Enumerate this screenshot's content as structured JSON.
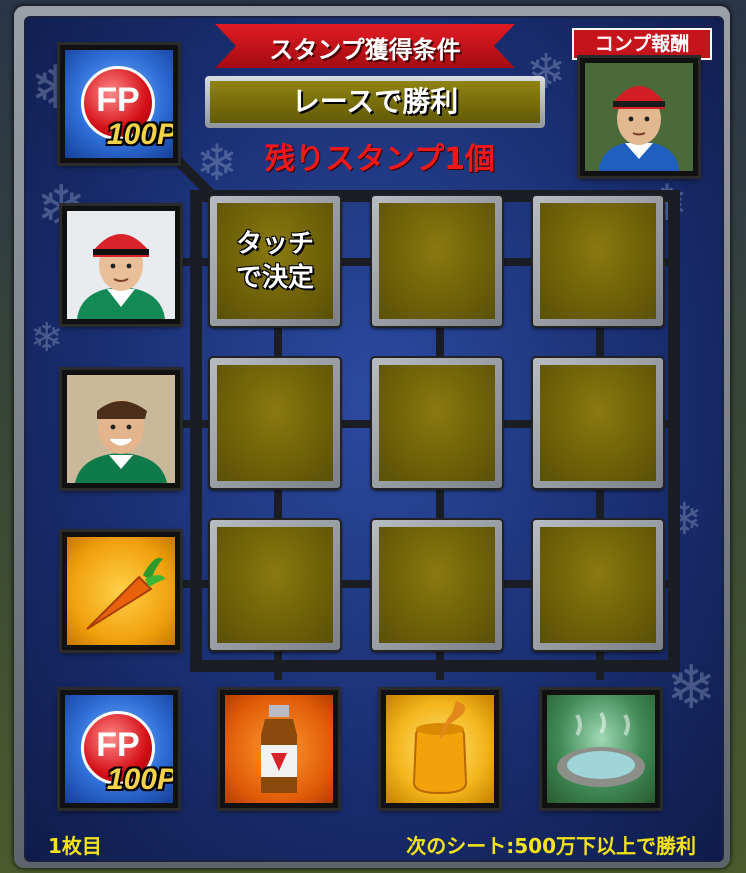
{
  "header": {
    "ribbon_title": "スタンプ獲得条件",
    "condition": "レースで勝利",
    "remaining": "残りスタンプ1個",
    "comp_reward_label": "コンプ報酬"
  },
  "grid": {
    "cells": [
      "タッチ\nで決定",
      "",
      "",
      "",
      "",
      "",
      "",
      "",
      ""
    ]
  },
  "rewards": {
    "corner_top_left": {
      "type": "fp",
      "coin": "FP",
      "points": "100P"
    },
    "corner_bottom_left": {
      "type": "fp",
      "coin": "FP",
      "points": "100P"
    },
    "row_rewards": [
      "jockey-portrait",
      "jockey-portrait",
      "carrot"
    ],
    "col_rewards": [
      "energy-drink",
      "honey",
      "hot-spring"
    ],
    "complete": "jockey-portrait"
  },
  "footer": {
    "sheet_number": "1枚目",
    "next_sheet": "次のシート:500万下以上で勝利"
  }
}
